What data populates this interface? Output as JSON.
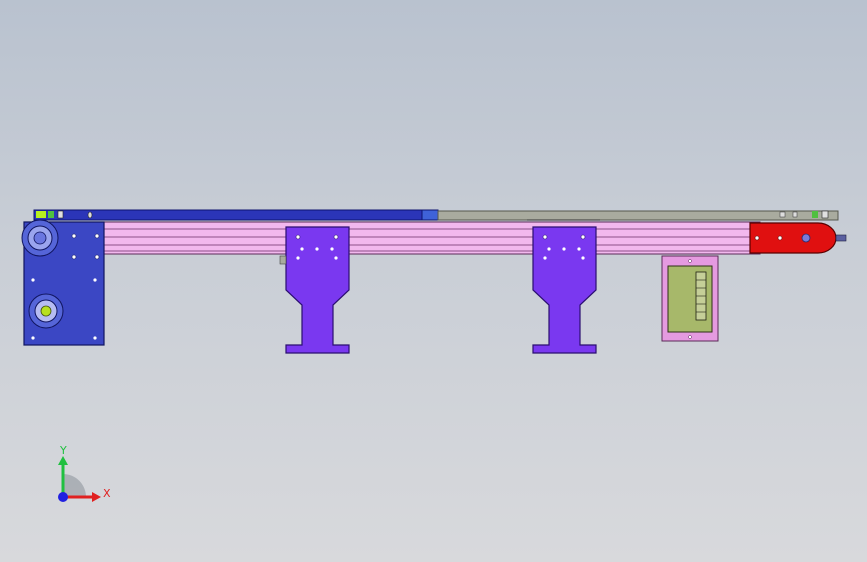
{
  "viewport": {
    "background_top": "#b9c2cf",
    "background_bottom": "#d8d9dc"
  },
  "model": {
    "rail_color": "#2b35b8",
    "belt_color": "#f2b8ee",
    "bracket_color": "#7a38f0",
    "drive_plate_color": "#3b47c4",
    "end_cap_color": "#e01010",
    "control_box_color": "#e59ae0",
    "screen_color": "#a7b86a"
  },
  "triad": {
    "x_label": "X",
    "y_label": "Y",
    "x_color": "#e02020",
    "y_color": "#20c040",
    "z_color": "#2020e0"
  }
}
